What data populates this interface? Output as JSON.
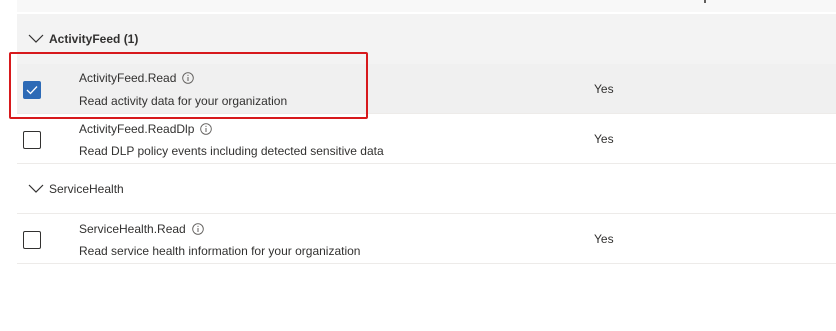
{
  "groups": [
    {
      "title": "ActivityFeed (1)",
      "expanded": true,
      "permissions": [
        {
          "name": "ActivityFeed.Read",
          "description": "Read activity data for your organization",
          "admin_consent": "Yes",
          "checked": true
        },
        {
          "name": "ActivityFeed.ReadDlp",
          "description": "Read DLP policy events including detected sensitive data",
          "admin_consent": "Yes",
          "checked": false
        }
      ]
    },
    {
      "title": "ServiceHealth",
      "expanded": true,
      "permissions": [
        {
          "name": "ServiceHealth.Read",
          "description": "Read service health information for your organization",
          "admin_consent": "Yes",
          "checked": false
        }
      ]
    }
  ],
  "colors": {
    "checkbox_checked": "#2d6ab6",
    "highlight": "#d7191c",
    "selected_row": "#f0f0f0"
  },
  "icons": {
    "chevron": "chevron-down-icon",
    "info": "info-icon",
    "check": "checkmark-icon"
  }
}
